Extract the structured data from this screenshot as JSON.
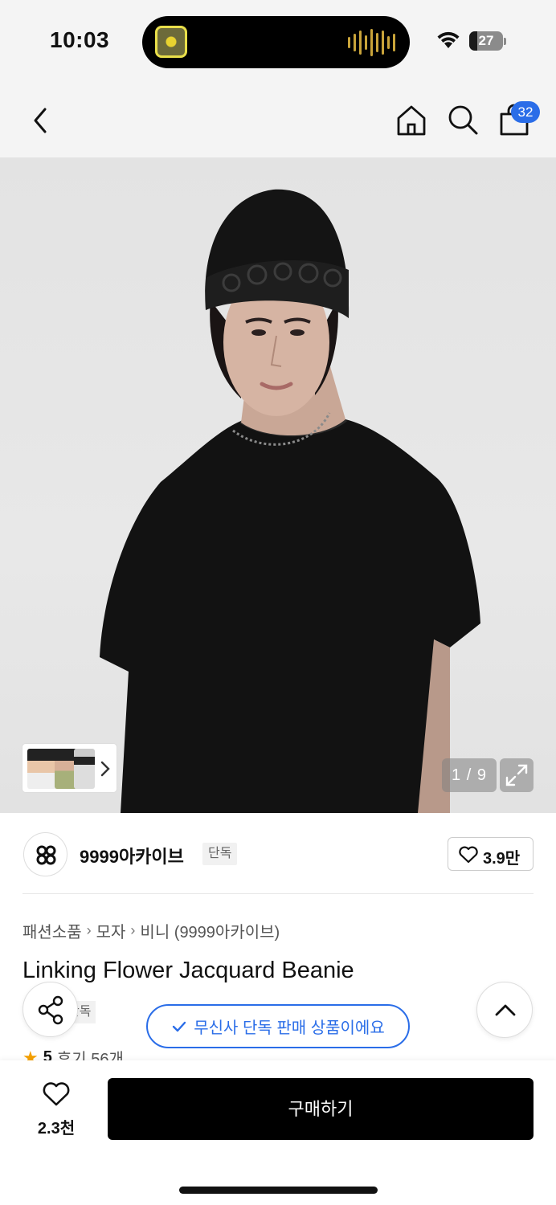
{
  "status_bar": {
    "time": "10:03",
    "battery": "27"
  },
  "header": {
    "cart_count": "32",
    "icons": [
      "back-chevron-icon",
      "home-icon",
      "search-icon",
      "shopping-bag-icon"
    ]
  },
  "gallery": {
    "pager": "1 / 9"
  },
  "brand": {
    "name": "9999아카이브",
    "tag": "단독",
    "likes": "3.9만"
  },
  "breadcrumb": [
    "패션소품",
    "모자",
    "비니 (9999아카이브)"
  ],
  "product": {
    "title": "Linking Flower Jacquard Beanie",
    "exclusive_tag": "단독",
    "rating": "5",
    "reviews": "후기 56개"
  },
  "notice": "무신사 단독 판매 상품이에요",
  "bottom_bar": {
    "wish_count": "2.3천",
    "buy_label": "구매하기"
  },
  "colors": {
    "accent": "#2a6de8",
    "buy_button": "#000000",
    "star": "#f5a000"
  }
}
